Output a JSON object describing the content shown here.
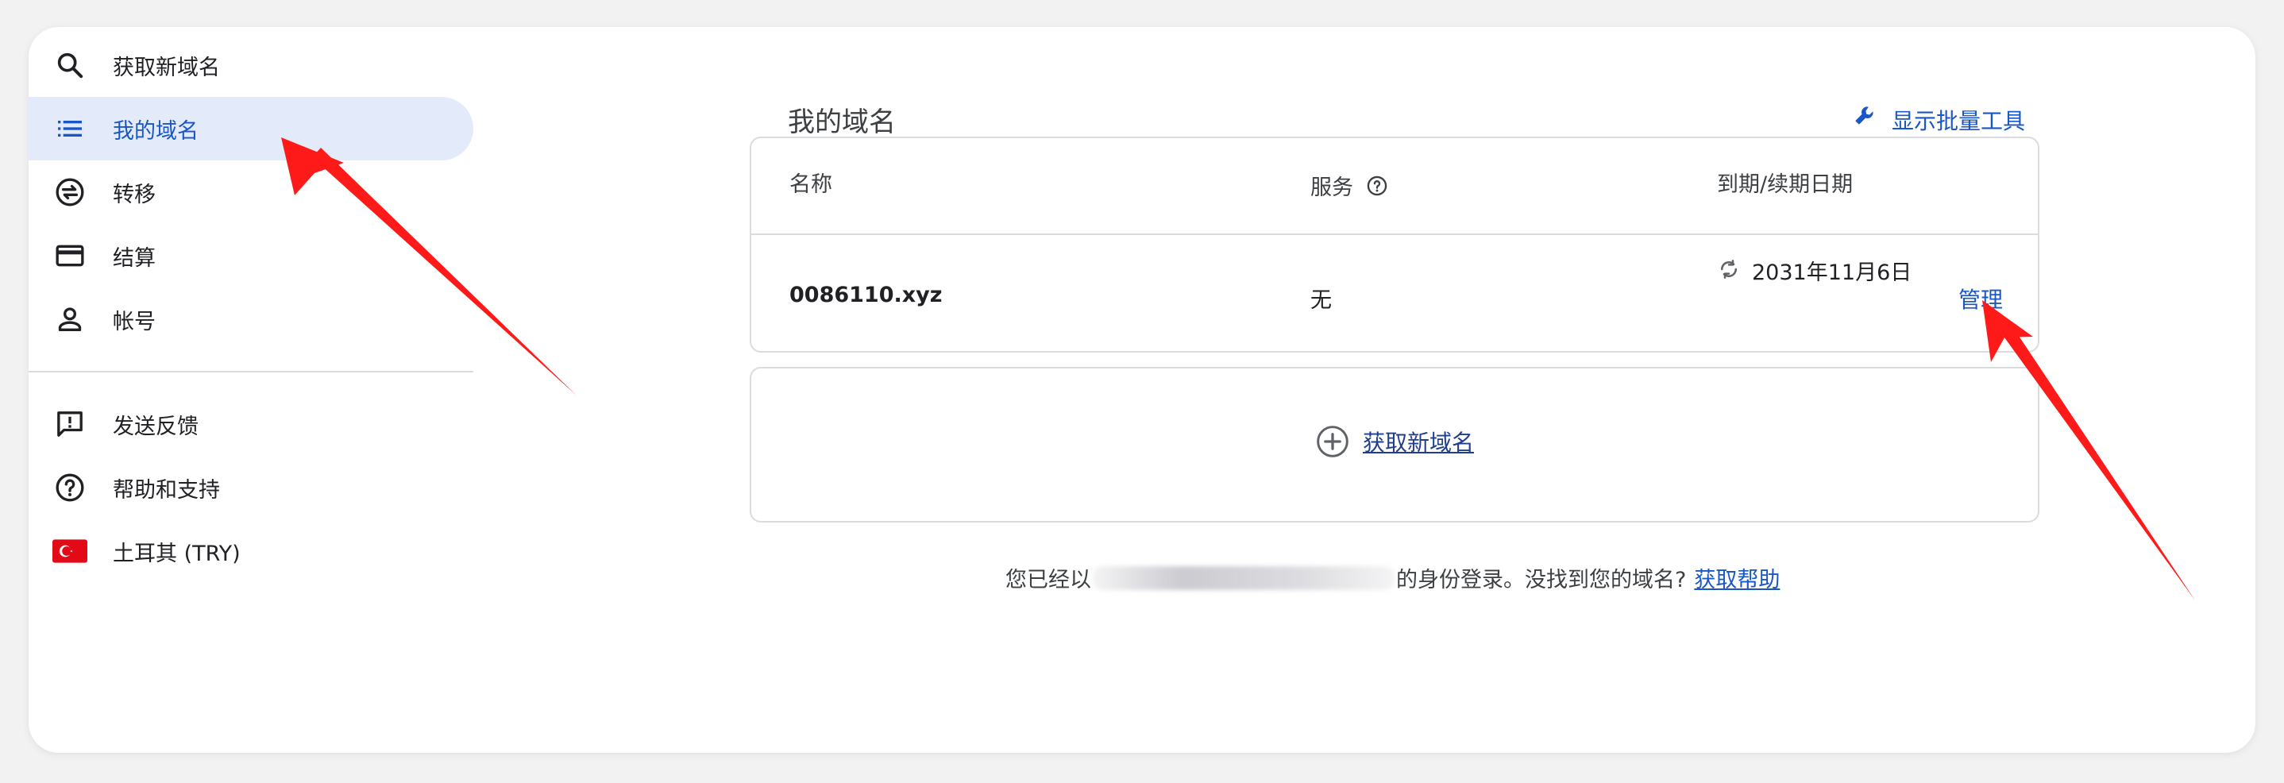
{
  "sidebar": {
    "items": [
      {
        "label": "获取新域名",
        "icon": "search-icon"
      },
      {
        "label": "我的域名",
        "icon": "list-icon",
        "active": true
      },
      {
        "label": "转移",
        "icon": "transfer-icon"
      },
      {
        "label": "结算",
        "icon": "credit-card-icon"
      },
      {
        "label": "帐号",
        "icon": "person-icon"
      },
      {
        "label": "发送反馈",
        "icon": "feedback-icon"
      },
      {
        "label": "帮助和支持",
        "icon": "help-icon"
      },
      {
        "label": "土耳其 (TRY)",
        "icon": "turkey-flag-icon"
      }
    ]
  },
  "main": {
    "title": "我的域名",
    "bulk_tools_label": "显示批量工具",
    "table": {
      "headers": {
        "name": "名称",
        "services": "服务",
        "expiry": "到期/续期日期"
      },
      "rows": [
        {
          "name": "0086110.xyz",
          "services": "无",
          "expiry": "2031年11月6日",
          "action": "管理"
        }
      ]
    },
    "add_domain_label": "获取新域名",
    "footer": {
      "prefix": "您已经以",
      "suffix": "的身份登录。没找到您的域名?",
      "help_link": "获取帮助"
    }
  },
  "colors": {
    "accent": "#1a57c6",
    "active_bg": "#e3ebfb",
    "annotation_arrow": "#ff1a1a"
  }
}
